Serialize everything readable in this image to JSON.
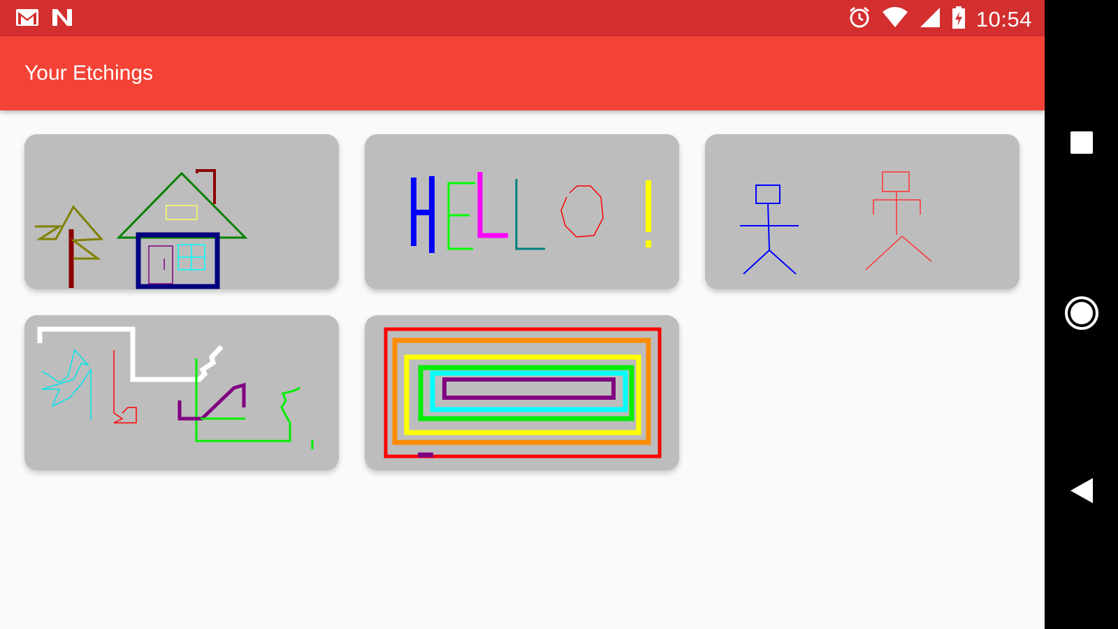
{
  "status_bar": {
    "time": "10:54",
    "left_icons": [
      "gmail-icon",
      "notification-n-icon"
    ],
    "right_icons": [
      "alarm-icon",
      "wifi-icon",
      "cell-signal-icon",
      "battery-charging-icon"
    ]
  },
  "app_bar": {
    "title": "Your Etchings"
  },
  "etchings": [
    {
      "subject": "tree and house"
    },
    {
      "subject": "HELLO!"
    },
    {
      "subject": "two stick figures"
    },
    {
      "subject": "colorful scribbles"
    },
    {
      "subject": "nested rainbow rectangles"
    }
  ],
  "nav_bar": {
    "buttons": [
      "recents-button",
      "home-button",
      "back-button"
    ]
  },
  "colors": {
    "status_bar": "#d32f2f",
    "app_bar": "#f44336",
    "card": "#bdbdbd",
    "background": "#fafafa"
  }
}
